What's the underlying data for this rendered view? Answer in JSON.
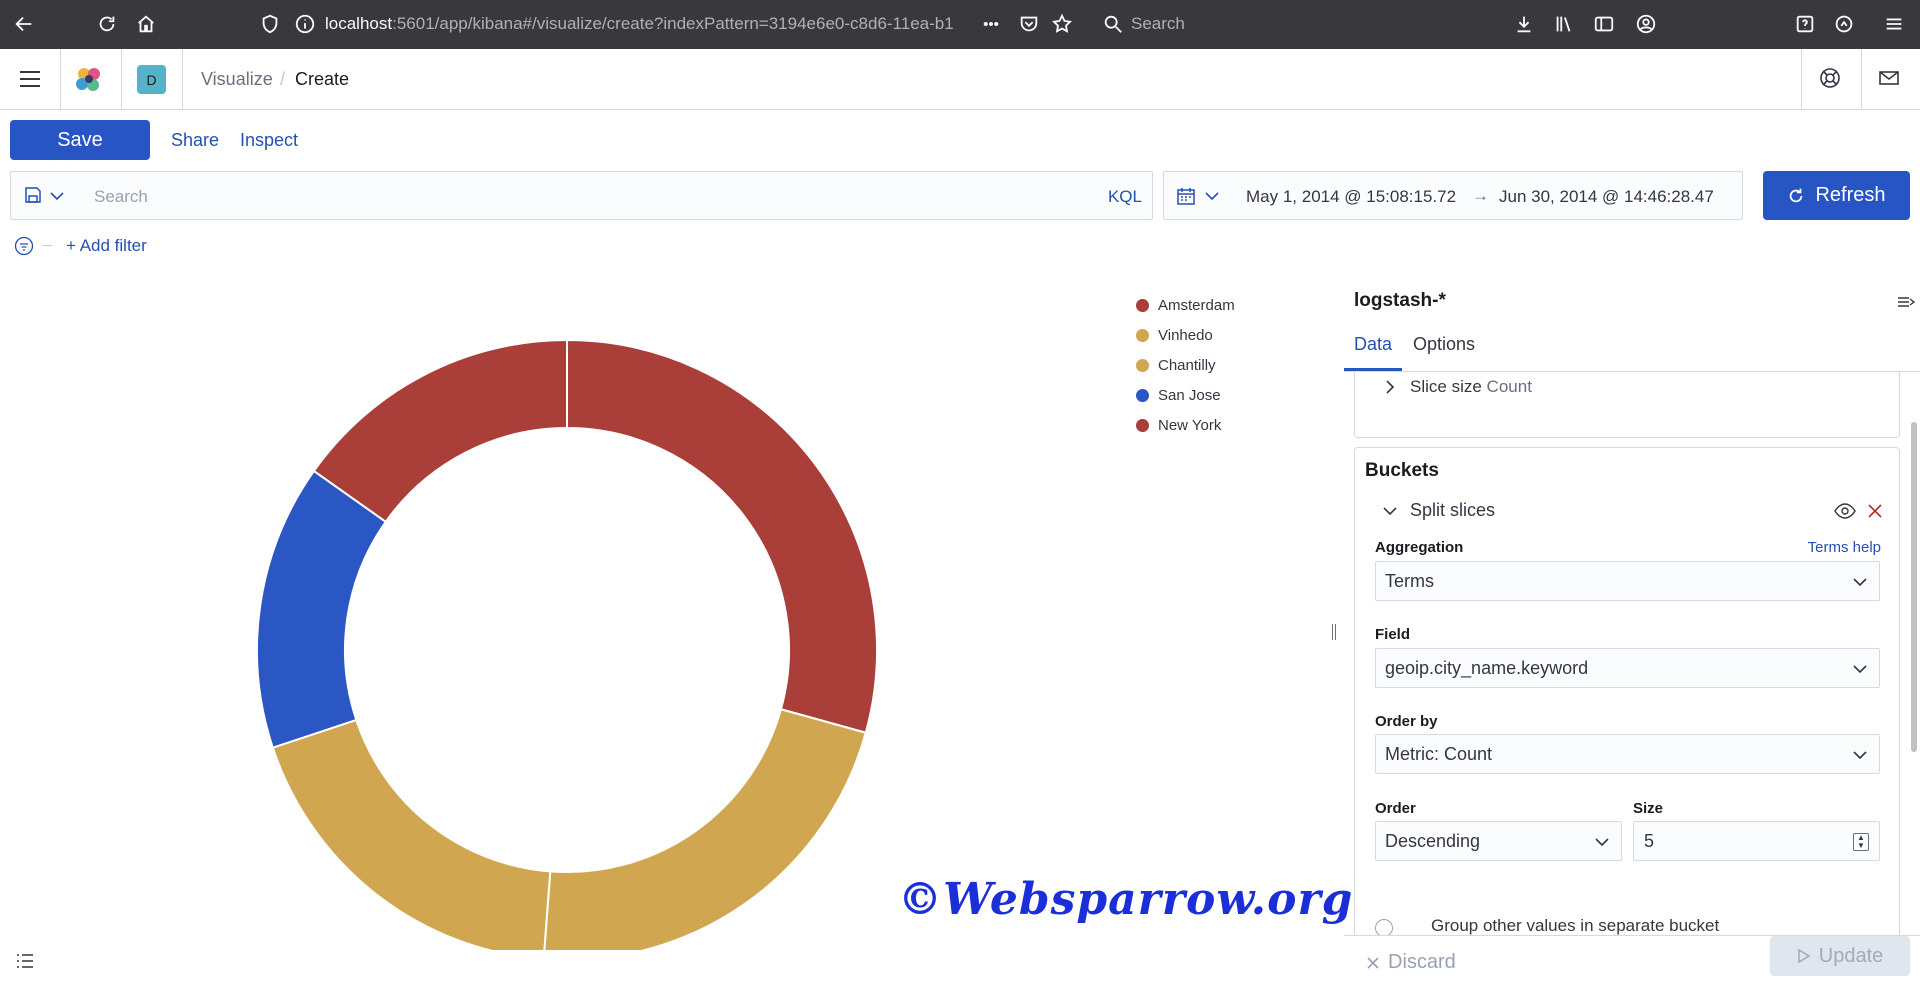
{
  "browser": {
    "url_host": "localhost",
    "url_rest": ":5601/app/kibana#/visualize/create?indexPattern=3194e6e0-c8d6-11ea-b1",
    "search_label": "Search",
    "more_label": "•••"
  },
  "header": {
    "space_initial": "D",
    "breadcrumbs": [
      "Visualize",
      "Create"
    ]
  },
  "toolbar": {
    "save_label": "Save",
    "share_label": "Share",
    "inspect_label": "Inspect"
  },
  "query": {
    "placeholder": "Search",
    "language": "KQL"
  },
  "time": {
    "start": "May 1, 2014 @ 15:08:15.72",
    "arrow": "→",
    "end": "Jun 30, 2014 @ 14:46:28.47",
    "refresh_label": "Refresh"
  },
  "filters": {
    "add_label": "+ Add filter"
  },
  "chart_data": {
    "type": "pie",
    "donut": true,
    "categories": [
      "Amsterdam",
      "Vinhedo",
      "Chantilly",
      "San Jose",
      "New York"
    ],
    "values": [
      29.3,
      21.9,
      18.7,
      14.9,
      15.2
    ],
    "colors": [
      "#a93f38",
      "#d0a651",
      "#d0a651",
      "#2a57c4",
      "#a93f38"
    ],
    "legend_position": "top-right"
  },
  "sidebar": {
    "index_pattern": "logstash-*",
    "tabs": [
      "Data",
      "Options"
    ],
    "metric": {
      "label": "Slice size",
      "value": "Count"
    },
    "buckets_title": "Buckets",
    "split_label": "Split slices",
    "aggregation": {
      "label": "Aggregation",
      "help": "Terms help",
      "value": "Terms"
    },
    "field": {
      "label": "Field",
      "value": "geoip.city_name.keyword"
    },
    "order_by": {
      "label": "Order by",
      "value": "Metric: Count"
    },
    "order": {
      "label": "Order",
      "value": "Descending"
    },
    "size": {
      "label": "Size",
      "value": "5"
    },
    "group_other_label": "Group other values in separate bucket",
    "discard_label": "Discard",
    "update_label": "Update"
  },
  "watermark": "©Websparrow.org"
}
